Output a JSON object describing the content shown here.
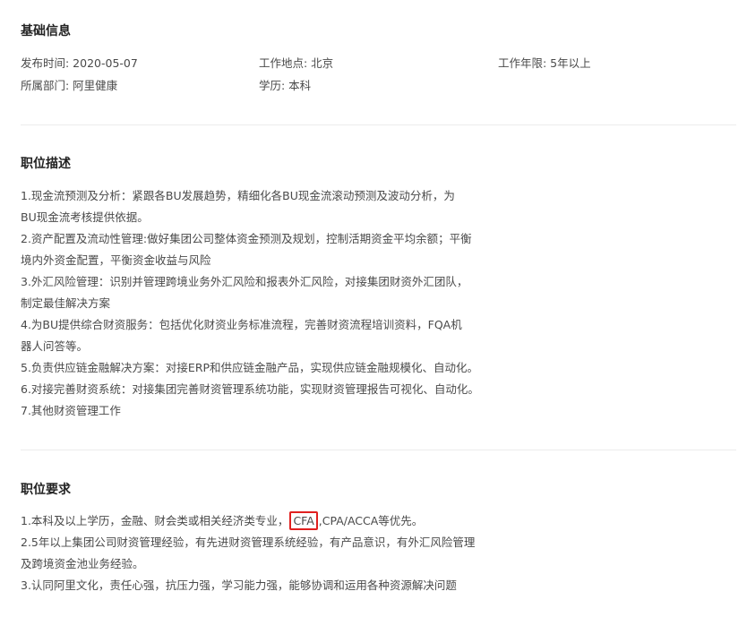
{
  "basic_info": {
    "title": "基础信息",
    "publish_date": "发布时间: 2020-05-07",
    "location": "工作地点: 北京",
    "experience": "工作年限: 5年以上",
    "department": "所属部门: 阿里健康",
    "education": "学历: 本科"
  },
  "description": {
    "title": "职位描述",
    "lines": [
      "1.现金流预测及分析：紧跟各BU发展趋势，精细化各BU现金流滚动预测及波动分析，为",
      "BU现金流考核提供依据。",
      "2.资产配置及流动性管理:做好集团公司整体资金预测及规划，控制活期资金平均余额；平衡",
      "境内外资金配置，平衡资金收益与风险",
      "3.外汇风险管理：识别并管理跨境业务外汇风险和报表外汇风险，对接集团财资外汇团队，",
      "制定最佳解决方案",
      "4.为BU提供综合财资服务：包括优化财资业务标准流程，完善财资流程培训资料，FQA机",
      "器人问答等。",
      "5.负责供应链金融解决方案：对接ERP和供应链金融产品，实现供应链金融规模化、自动化。",
      "6.对接完善财资系统：对接集团完善财资管理系统功能，实现财资管理报告可视化、自动化。",
      "7.其他财资管理工作"
    ]
  },
  "requirements": {
    "title": "职位要求",
    "line1_prefix": "1.本科及以上学历，金融、财会类或相关经济类专业，",
    "line1_highlight": "CFA",
    "line1_suffix": ",CPA/ACCA等优先。",
    "lines": [
      "2.5年以上集团公司财资管理经验，有先进财资管理系统经验，有产品意识，有外汇风险管理",
      "及跨境资金池业务经验。",
      "3.认同阿里文化，责任心强，抗压力强，学习能力强，能够协调和运用各种资源解决问题"
    ]
  },
  "colors": {
    "highlight_border": "#e0201f",
    "divider": "#ececec"
  }
}
